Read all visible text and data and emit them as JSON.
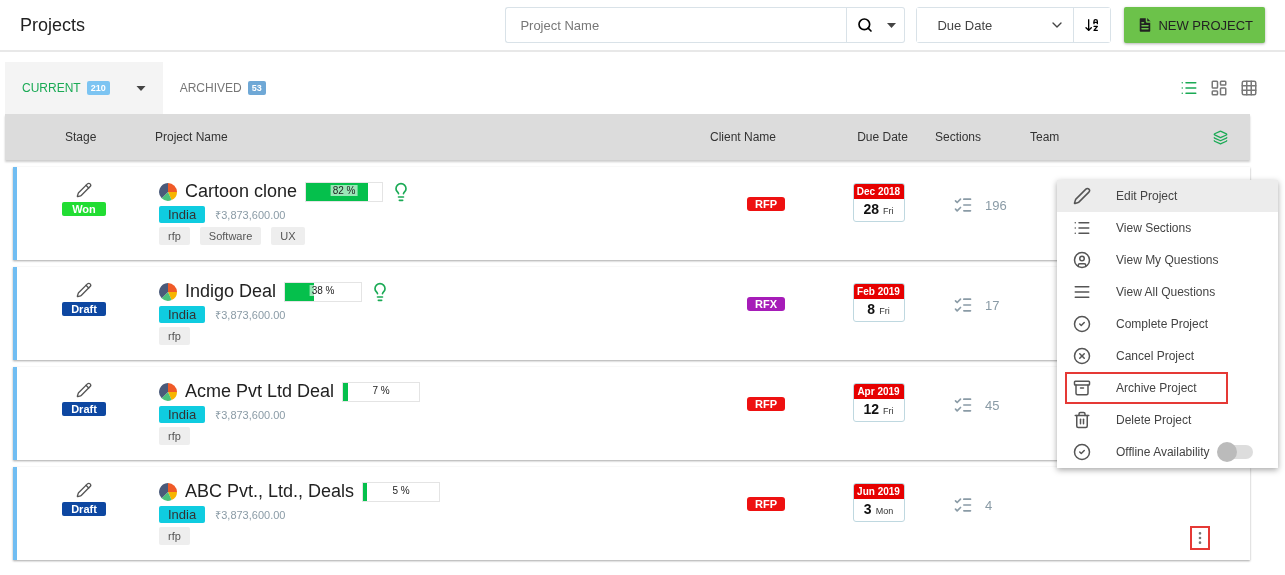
{
  "header": {
    "title": "Projects",
    "search": {
      "placeholder": "Project Name"
    },
    "sort": {
      "value": "Due Date"
    },
    "new_button": "NEW PROJECT"
  },
  "tabs": [
    {
      "label": "CURRENT",
      "count": "210",
      "selected": true
    },
    {
      "label": "ARCHIVED",
      "count": "53",
      "selected": false
    }
  ],
  "views": [
    {
      "selected": true
    },
    {
      "selected": false
    },
    {
      "selected": false
    }
  ],
  "table": {
    "columns": [
      "Stage",
      "Project Name",
      "Client Name",
      "Due Date",
      "Sections",
      "Team"
    ],
    "rows": [
      {
        "stage": {
          "label": "Won",
          "color": "#22dd33"
        },
        "name": "Cartoon clone",
        "progress": {
          "level": 0.82,
          "reading": "82 %"
        },
        "lightbulb": true,
        "region": "India",
        "amount": "₹3,873,600.00",
        "tags": [
          "rfp",
          "Software",
          "UX"
        ],
        "client": {
          "label": "RFP",
          "color": "#ee1111"
        },
        "due_month": "Dec 2018",
        "due_day": "28",
        "due_weekday": "Fri",
        "sections": "196",
        "menu_marked": false
      },
      {
        "stage": {
          "label": "Draft",
          "color": "#0d47a1"
        },
        "name": "Indigo Deal",
        "progress": {
          "level": 0.38,
          "reading": "38 %"
        },
        "lightbulb": true,
        "region": "India",
        "amount": "₹3,873,600.00",
        "tags": [
          "rfp"
        ],
        "client": {
          "label": "RFX",
          "color": "#a61cb8"
        },
        "due_month": "Feb 2019",
        "due_day": "8",
        "due_weekday": "Fri",
        "sections": "17",
        "menu_marked": false
      },
      {
        "stage": {
          "label": "Draft",
          "color": "#0d47a1"
        },
        "name": "Acme Pvt Ltd Deal",
        "progress": {
          "level": 0.07,
          "reading": "7 %"
        },
        "lightbulb": false,
        "region": "India",
        "amount": "₹3,873,600.00",
        "tags": [
          "rfp"
        ],
        "client": {
          "label": "RFP",
          "color": "#ee1111"
        },
        "due_month": "Apr 2019",
        "due_day": "12",
        "due_weekday": "Fri",
        "sections": "45",
        "menu_marked": false
      },
      {
        "stage": {
          "label": "Draft",
          "color": "#0d47a1"
        },
        "name": "ABC Pvt., Ltd., Deals",
        "progress": {
          "level": 0.05,
          "reading": "5 %"
        },
        "lightbulb": false,
        "region": "India",
        "amount": "₹3,873,600.00",
        "tags": [
          "rfp"
        ],
        "client": {
          "label": "RFP",
          "color": "#ee1111"
        },
        "due_month": "Jun 2019",
        "due_day": "3",
        "due_weekday": "Mon",
        "sections": "4",
        "menu_marked": true
      }
    ]
  },
  "context_menu": {
    "items": [
      {
        "kind": "action",
        "label": "Edit Project",
        "selected": true,
        "marked": false
      },
      {
        "kind": "action",
        "label": "View Sections",
        "selected": false,
        "marked": false
      },
      {
        "kind": "action",
        "label": "View My Questions",
        "selected": false,
        "marked": false
      },
      {
        "kind": "action",
        "label": "View All Questions",
        "selected": false,
        "marked": false
      },
      {
        "kind": "action",
        "label": "Complete Project",
        "selected": false,
        "marked": false
      },
      {
        "kind": "action",
        "label": "Cancel Project",
        "selected": false,
        "marked": false
      },
      {
        "kind": "action",
        "label": "Archive Project",
        "selected": false,
        "marked": true
      },
      {
        "kind": "action",
        "label": "Delete Project",
        "selected": false,
        "marked": false
      },
      {
        "kind": "toggle",
        "label": "Offline Availability",
        "selected": false,
        "marked": false,
        "on": false
      }
    ]
  }
}
